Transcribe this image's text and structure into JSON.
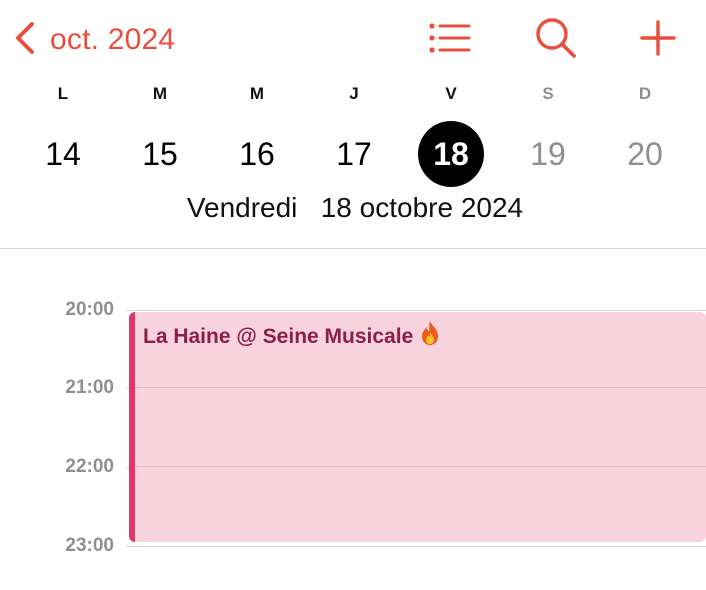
{
  "header": {
    "month_label": "oct. 2024",
    "accent_color": "#eb4d3d",
    "icons": [
      "chevron-left-icon",
      "list-icon",
      "search-icon",
      "plus-icon"
    ]
  },
  "week": {
    "weekdays": [
      "L",
      "M",
      "M",
      "J",
      "V",
      "S",
      "D"
    ],
    "days": [
      "14",
      "15",
      "16",
      "17",
      "18",
      "19",
      "20"
    ],
    "selected_day": "18"
  },
  "date_label": "Vendredi   18 octobre 2024",
  "timeline": {
    "hours": [
      "20:00",
      "21:00",
      "22:00",
      "23:00"
    ]
  },
  "event": {
    "title": "La Haine @ Seine Musicale",
    "emoji_icon": "fire-icon",
    "color": "#f8d3de",
    "bar_color": "#e0386a"
  }
}
